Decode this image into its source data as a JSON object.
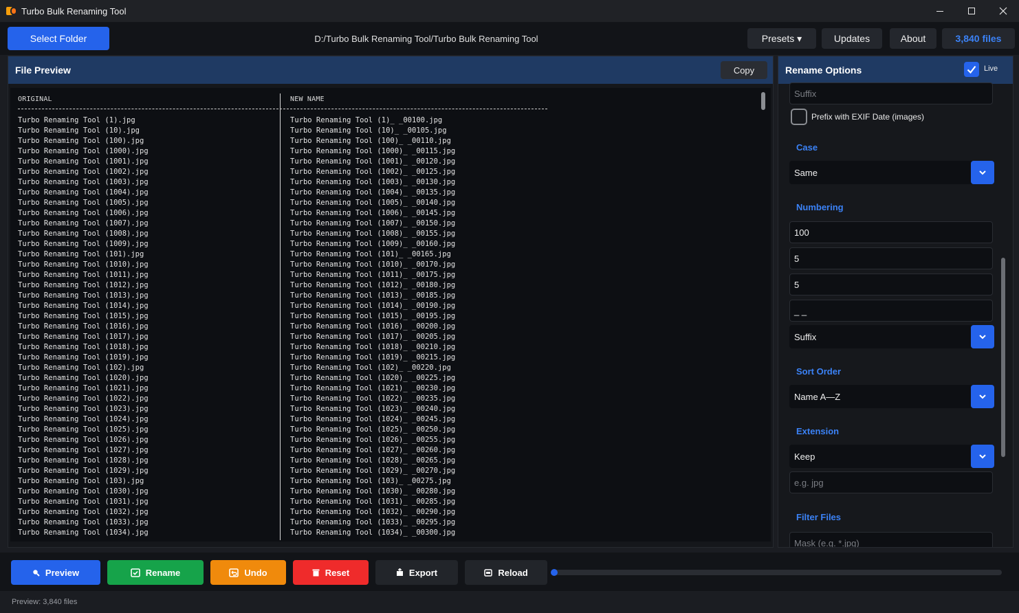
{
  "window": {
    "title": "Turbo Bulk Renaming Tool"
  },
  "toolbar": {
    "select_folder": "Select Folder",
    "path": "D:/Turbo Bulk Renaming Tool/Turbo Bulk Renaming Tool",
    "presets": "Presets ▾",
    "updates": "Updates",
    "about": "About",
    "files_count": "3,840 files"
  },
  "file_preview": {
    "title": "File Preview",
    "copy": "Copy",
    "col_original": "ORIGINAL",
    "col_new": "NEW NAME",
    "rows": [
      {
        "original": "Turbo Renaming Tool (1).jpg",
        "new": "Turbo Renaming Tool (1)_ _00100.jpg"
      },
      {
        "original": "Turbo Renaming Tool (10).jpg",
        "new": "Turbo Renaming Tool (10)_ _00105.jpg"
      },
      {
        "original": "Turbo Renaming Tool (100).jpg",
        "new": "Turbo Renaming Tool (100)_ _00110.jpg"
      },
      {
        "original": "Turbo Renaming Tool (1000).jpg",
        "new": "Turbo Renaming Tool (1000)_ _00115.jpg"
      },
      {
        "original": "Turbo Renaming Tool (1001).jpg",
        "new": "Turbo Renaming Tool (1001)_ _00120.jpg"
      },
      {
        "original": "Turbo Renaming Tool (1002).jpg",
        "new": "Turbo Renaming Tool (1002)_ _00125.jpg"
      },
      {
        "original": "Turbo Renaming Tool (1003).jpg",
        "new": "Turbo Renaming Tool (1003)_ _00130.jpg"
      },
      {
        "original": "Turbo Renaming Tool (1004).jpg",
        "new": "Turbo Renaming Tool (1004)_ _00135.jpg"
      },
      {
        "original": "Turbo Renaming Tool (1005).jpg",
        "new": "Turbo Renaming Tool (1005)_ _00140.jpg"
      },
      {
        "original": "Turbo Renaming Tool (1006).jpg",
        "new": "Turbo Renaming Tool (1006)_ _00145.jpg"
      },
      {
        "original": "Turbo Renaming Tool (1007).jpg",
        "new": "Turbo Renaming Tool (1007)_ _00150.jpg"
      },
      {
        "original": "Turbo Renaming Tool (1008).jpg",
        "new": "Turbo Renaming Tool (1008)_ _00155.jpg"
      },
      {
        "original": "Turbo Renaming Tool (1009).jpg",
        "new": "Turbo Renaming Tool (1009)_ _00160.jpg"
      },
      {
        "original": "Turbo Renaming Tool (101).jpg",
        "new": "Turbo Renaming Tool (101)_ _00165.jpg"
      },
      {
        "original": "Turbo Renaming Tool (1010).jpg",
        "new": "Turbo Renaming Tool (1010)_ _00170.jpg"
      },
      {
        "original": "Turbo Renaming Tool (1011).jpg",
        "new": "Turbo Renaming Tool (1011)_ _00175.jpg"
      },
      {
        "original": "Turbo Renaming Tool (1012).jpg",
        "new": "Turbo Renaming Tool (1012)_ _00180.jpg"
      },
      {
        "original": "Turbo Renaming Tool (1013).jpg",
        "new": "Turbo Renaming Tool (1013)_ _00185.jpg"
      },
      {
        "original": "Turbo Renaming Tool (1014).jpg",
        "new": "Turbo Renaming Tool (1014)_ _00190.jpg"
      },
      {
        "original": "Turbo Renaming Tool (1015).jpg",
        "new": "Turbo Renaming Tool (1015)_ _00195.jpg"
      },
      {
        "original": "Turbo Renaming Tool (1016).jpg",
        "new": "Turbo Renaming Tool (1016)_ _00200.jpg"
      },
      {
        "original": "Turbo Renaming Tool (1017).jpg",
        "new": "Turbo Renaming Tool (1017)_ _00205.jpg"
      },
      {
        "original": "Turbo Renaming Tool (1018).jpg",
        "new": "Turbo Renaming Tool (1018)_ _00210.jpg"
      },
      {
        "original": "Turbo Renaming Tool (1019).jpg",
        "new": "Turbo Renaming Tool (1019)_ _00215.jpg"
      },
      {
        "original": "Turbo Renaming Tool (102).jpg",
        "new": "Turbo Renaming Tool (102)_ _00220.jpg"
      },
      {
        "original": "Turbo Renaming Tool (1020).jpg",
        "new": "Turbo Renaming Tool (1020)_ _00225.jpg"
      },
      {
        "original": "Turbo Renaming Tool (1021).jpg",
        "new": "Turbo Renaming Tool (1021)_ _00230.jpg"
      },
      {
        "original": "Turbo Renaming Tool (1022).jpg",
        "new": "Turbo Renaming Tool (1022)_ _00235.jpg"
      },
      {
        "original": "Turbo Renaming Tool (1023).jpg",
        "new": "Turbo Renaming Tool (1023)_ _00240.jpg"
      },
      {
        "original": "Turbo Renaming Tool (1024).jpg",
        "new": "Turbo Renaming Tool (1024)_ _00245.jpg"
      },
      {
        "original": "Turbo Renaming Tool (1025).jpg",
        "new": "Turbo Renaming Tool (1025)_ _00250.jpg"
      },
      {
        "original": "Turbo Renaming Tool (1026).jpg",
        "new": "Turbo Renaming Tool (1026)_ _00255.jpg"
      },
      {
        "original": "Turbo Renaming Tool (1027).jpg",
        "new": "Turbo Renaming Tool (1027)_ _00260.jpg"
      },
      {
        "original": "Turbo Renaming Tool (1028).jpg",
        "new": "Turbo Renaming Tool (1028)_ _00265.jpg"
      },
      {
        "original": "Turbo Renaming Tool (1029).jpg",
        "new": "Turbo Renaming Tool (1029)_ _00270.jpg"
      },
      {
        "original": "Turbo Renaming Tool (103).jpg",
        "new": "Turbo Renaming Tool (103)_ _00275.jpg"
      },
      {
        "original": "Turbo Renaming Tool (1030).jpg",
        "new": "Turbo Renaming Tool (1030)_ _00280.jpg"
      },
      {
        "original": "Turbo Renaming Tool (1031).jpg",
        "new": "Turbo Renaming Tool (1031)_ _00285.jpg"
      },
      {
        "original": "Turbo Renaming Tool (1032).jpg",
        "new": "Turbo Renaming Tool (1032)_ _00290.jpg"
      },
      {
        "original": "Turbo Renaming Tool (1033).jpg",
        "new": "Turbo Renaming Tool (1033)_ _00295.jpg"
      },
      {
        "original": "Turbo Renaming Tool (1034).jpg",
        "new": "Turbo Renaming Tool (1034)_ _00300.jpg"
      }
    ]
  },
  "rename_options": {
    "title": "Rename Options",
    "live_label": "Live",
    "live_checked": true,
    "suffix_placeholder": "Suffix",
    "exif_label": "Prefix with EXIF Date (images)",
    "case": {
      "title": "Case",
      "value": "Same"
    },
    "numbering": {
      "title": "Numbering",
      "start": "100",
      "step": "5",
      "padding": "5",
      "separator": "_ _",
      "position": "Suffix"
    },
    "sort_order": {
      "title": "Sort Order",
      "value": "Name A—Z"
    },
    "extension": {
      "title": "Extension",
      "value": "Keep",
      "placeholder": "e.g. jpg"
    },
    "filter_files": {
      "title": "Filter Files",
      "placeholder": "Mask (e.g. *.jpg)"
    }
  },
  "actions": {
    "preview": "Preview",
    "rename": "Rename",
    "undo": "Undo",
    "reset": "Reset",
    "export": "Export",
    "reload": "Reload",
    "progress": 0
  },
  "status": {
    "text": "Preview: 3,840 files"
  },
  "colors": {
    "accent": "#2563eb",
    "section_title": "#3b82f6",
    "rename": "#16a34a",
    "undo": "#f08a0c",
    "reset": "#ef2b2b"
  }
}
